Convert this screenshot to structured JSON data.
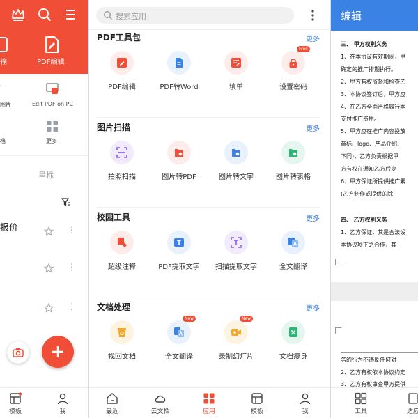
{
  "left_panel": {
    "header_labels": [
      "输",
      "PDF编辑"
    ],
    "small_tools": [
      {
        "label": "图片",
        "icon": "image-icon"
      },
      {
        "label": "Edit PDF on PC",
        "icon": "pc-pdf-icon"
      },
      {
        "label": "档",
        "icon": "doc-icon"
      },
      {
        "label": "更多",
        "icon": "more-grid-icon"
      }
    ],
    "tab_label": "星标",
    "list_title": "报价",
    "nav": [
      {
        "label": "模板",
        "icon": "template-icon"
      },
      {
        "label": "我",
        "icon": "user-icon"
      }
    ]
  },
  "middle_panel": {
    "search_placeholder": "搜索应用",
    "sections": [
      {
        "title": "PDF工具包",
        "more": "更多",
        "tools": [
          {
            "label": "PDF编辑",
            "icon": "pdf-edit-icon",
            "color": "#f04e37",
            "bg": "#fdecea"
          },
          {
            "label": "PDF转Word",
            "icon": "pdf-to-word-icon",
            "color": "#3b82e5",
            "bg": "#e8f1fc"
          },
          {
            "label": "填单",
            "icon": "fill-form-icon",
            "color": "#f04e37",
            "bg": "#fdecea"
          },
          {
            "label": "设置密码",
            "icon": "lock-icon",
            "color": "#f04e37",
            "bg": "#fdecea",
            "badge": "Free"
          }
        ]
      },
      {
        "title": "图片扫描",
        "more": "更多",
        "tools": [
          {
            "label": "拍照扫描",
            "icon": "scan-icon",
            "color": "#8a5ce6",
            "bg": "#f1ebfc"
          },
          {
            "label": "图片转PDF",
            "icon": "image-to-pdf-icon",
            "color": "#f04e37",
            "bg": "#fdecea"
          },
          {
            "label": "图片转文字",
            "icon": "image-to-text-icon",
            "color": "#3b82e5",
            "bg": "#e8f1fc"
          },
          {
            "label": "图片转表格",
            "icon": "image-to-table-icon",
            "color": "#2bb673",
            "bg": "#e5f6ee"
          }
        ]
      },
      {
        "title": "校园工具",
        "more": "更多",
        "tools": [
          {
            "label": "超级注释",
            "icon": "annotate-icon",
            "color": "#f04e37",
            "bg": "#fdecea"
          },
          {
            "label": "PDF提取文字",
            "icon": "pdf-extract-text-icon",
            "color": "#3b82e5",
            "bg": "#e8f1fc"
          },
          {
            "label": "扫描提取文字",
            "icon": "scan-extract-text-icon",
            "color": "#8a5ce6",
            "bg": "#f1ebfc"
          },
          {
            "label": "全文翻译",
            "icon": "translate-icon",
            "color": "#3b82e5",
            "bg": "#e8f1fc"
          }
        ]
      },
      {
        "title": "文档处理",
        "more": "更多",
        "tools": [
          {
            "label": "找回文档",
            "icon": "recover-doc-icon",
            "color": "#f5a623",
            "bg": "#fdf3e1"
          },
          {
            "label": "全文翻译",
            "icon": "translate-icon",
            "color": "#3b82e5",
            "bg": "#e8f1fc",
            "badge": "New"
          },
          {
            "label": "录制幻灯片",
            "icon": "record-slides-icon",
            "color": "#f5a623",
            "bg": "#fdf3e1",
            "badge": "New"
          },
          {
            "label": "文档瘦身",
            "icon": "compress-doc-icon",
            "color": "#2bb673",
            "bg": "#e5f6ee"
          }
        ]
      }
    ],
    "nav": [
      {
        "label": "最近",
        "icon": "home-icon"
      },
      {
        "label": "云文档",
        "icon": "cloud-icon"
      },
      {
        "label": "应用",
        "icon": "apps-icon",
        "active": true
      },
      {
        "label": "模板",
        "icon": "template-icon"
      },
      {
        "label": "我",
        "icon": "user-icon"
      }
    ]
  },
  "right_panel": {
    "title": "编辑",
    "doc_lines": [
      "三、    甲方权利义务",
      "1、在本协议有效期间，甲",
      "     确定的推广排期执行。",
      "2、甲方有权监督和检查乙",
      "3、本协议签订后，甲方应",
      "4、在乙方全面严格履行本",
      "     支付推广费用。",
      "5、甲方应在推广内容投放",
      "     商标、logo、产品介绍、",
      "     下同)，乙方负责根据甲",
      "     方有权在通知乙方后变",
      "6、甲方保证所提供推广素",
      "     (乙方制作或提供的除"
    ],
    "doc_lines_2": [
      "四、    乙方权利义务",
      "1、乙方保证：其是合法设",
      "     本协议项下之合作，其"
    ],
    "doc_lines_3": [
      "     务的行为不违反任何对",
      "2、乙方有权依本协议约定",
      "3、乙方有权审查甲方提供"
    ],
    "nav": [
      {
        "label": "工具",
        "icon": "tools-icon"
      },
      {
        "label": "适应",
        "icon": "fit-icon"
      }
    ]
  },
  "colors": {
    "accent_red": "#f04e37",
    "accent_blue": "#3b82e5"
  }
}
